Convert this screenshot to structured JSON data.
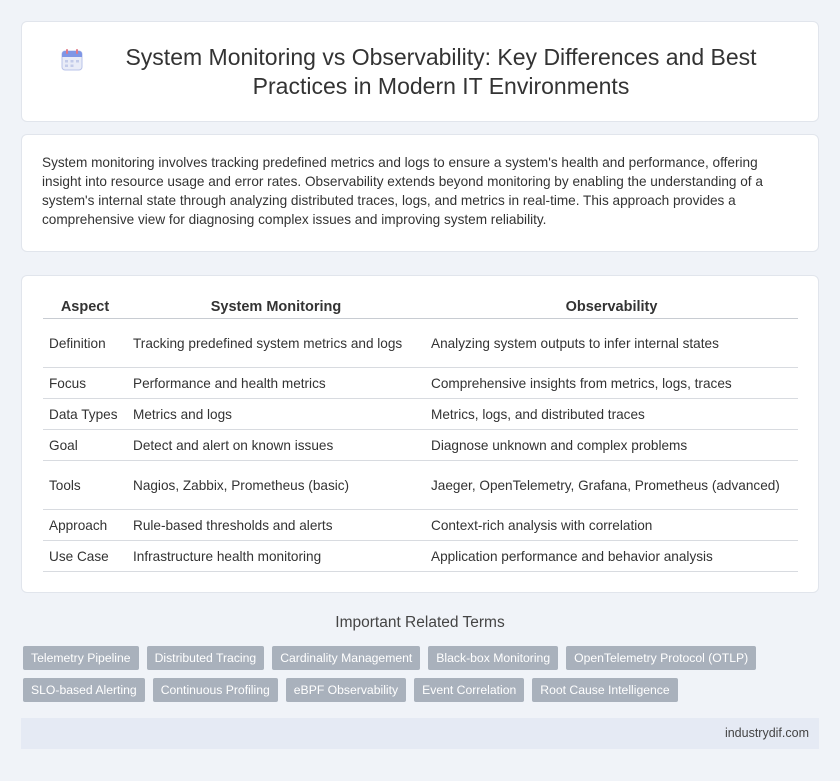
{
  "header": {
    "title": "System Monitoring vs Observability: Key Differences and Best Practices in Modern IT Environments",
    "icon": "calendar-icon"
  },
  "intro": {
    "text": "System monitoring involves tracking predefined metrics and logs to ensure a system's health and performance, offering insight into resource usage and error rates. Observability extends beyond monitoring by enabling the understanding of a system's internal state through analyzing distributed traces, logs, and metrics in real-time. This approach provides a comprehensive view for diagnosing complex issues and improving system reliability."
  },
  "table": {
    "headers": [
      "Aspect",
      "System Monitoring",
      "Observability"
    ],
    "rows": [
      [
        "Definition",
        "Tracking predefined system metrics and logs",
        "Analyzing system outputs to infer internal states"
      ],
      [
        "Focus",
        "Performance and health metrics",
        "Comprehensive insights from metrics, logs, traces"
      ],
      [
        "Data Types",
        "Metrics and logs",
        "Metrics, logs, and distributed traces"
      ],
      [
        "Goal",
        "Detect and alert on known issues",
        "Diagnose unknown and complex problems"
      ],
      [
        "Tools",
        "Nagios, Zabbix, Prometheus (basic)",
        "Jaeger, OpenTelemetry, Grafana, Prometheus (advanced)"
      ],
      [
        "Approach",
        "Rule-based thresholds and alerts",
        "Context-rich analysis with correlation"
      ],
      [
        "Use Case",
        "Infrastructure health monitoring",
        "Application performance and behavior analysis"
      ]
    ]
  },
  "related": {
    "heading": "Important Related Terms",
    "tags": [
      "Telemetry Pipeline",
      "Distributed Tracing",
      "Cardinality Management",
      "Black-box Monitoring",
      "OpenTelemetry Protocol (OTLP)",
      "SLO-based Alerting",
      "Continuous Profiling",
      "eBPF Observability",
      "Event Correlation",
      "Root Cause Intelligence"
    ]
  },
  "footer": {
    "site": "industrydif.com"
  },
  "colors": {
    "background": "#f0f3f8",
    "tag": "#a9b1bc",
    "footer": "#e5eaf4"
  }
}
